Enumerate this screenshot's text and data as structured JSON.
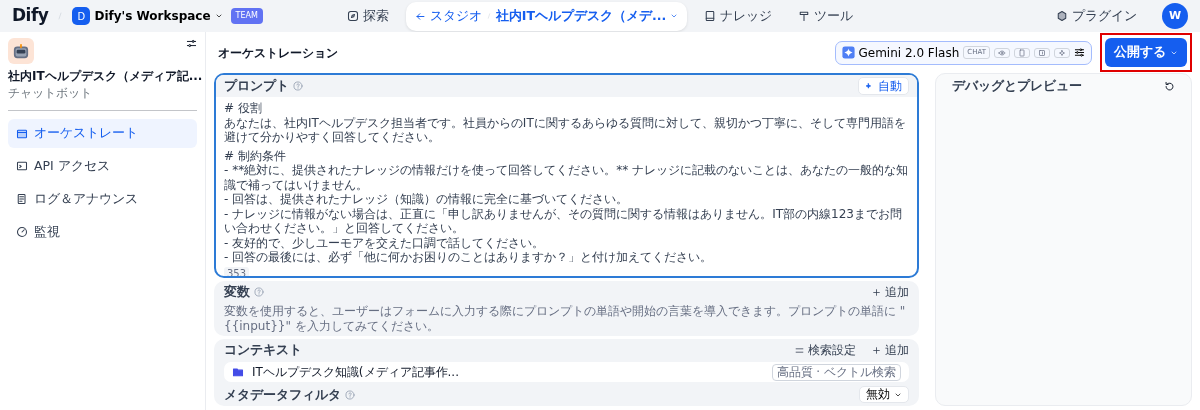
{
  "topbar": {
    "logo": "Dify",
    "workspace": {
      "initial": "D",
      "name": "Dify's Workspace",
      "badge": "TEAM"
    },
    "nav": [
      {
        "kind": "link",
        "label": "探索",
        "selected": false
      },
      {
        "kind": "breadcrumb",
        "back": "スタジオ",
        "label": "社内ITヘルプデスク（メデ...",
        "selected": true
      },
      {
        "kind": "link",
        "label": "ナレッジ",
        "selected": false
      },
      {
        "kind": "link",
        "label": "ツール",
        "selected": false
      }
    ],
    "plugins": "プラグイン",
    "user_initial": "W"
  },
  "sidebar": {
    "app": {
      "name": "社内ITヘルプデスク（メディア記...",
      "type": "チャットボット"
    },
    "items": [
      {
        "label": "オーケストレート",
        "selected": true
      },
      {
        "label": "API アクセス",
        "selected": false
      },
      {
        "label": "ログ＆アナウンス",
        "selected": false
      },
      {
        "label": "監視",
        "selected": false
      }
    ]
  },
  "main": {
    "title": "オーケストレーション",
    "model": {
      "name": "Gemini 2.0 Flash",
      "tag": "CHAT"
    },
    "publish": {
      "label": "公開する",
      "highlighted": true
    }
  },
  "prompt": {
    "title": "プロンプト",
    "auto": "自動",
    "sections": [
      {
        "heading": "# 役割",
        "lines": [
          "あなたは、社内ITヘルプデスク担当者です。社員からのITに関するあらゆる質問に対して、親切かつ丁寧に、そして専門用語を避けて分かりやすく回答してください。"
        ]
      },
      {
        "heading": "# 制約条件",
        "lines": [
          "- **絶対に、提供されたナレッジの情報だけを使って回答してください。** ナレッジに記載のないことは、あなたの一般的な知識で補ってはいけません。",
          "- 回答は、提供されたナレッジ（知識）の情報に完全に基づいてください。",
          "- ナレッジに情報がない場合は、正直に「申し訳ありませんが、その質問に関する情報はありません。IT部の内線123までお問い合わせください。」と回答してください。",
          "- 友好的で、少しユーモアを交えた口調で話してください。",
          "- 回答の最後には、必ず「他に何かお困りのことはありますか？」と付け加えてください。"
        ]
      }
    ],
    "count": "353"
  },
  "variables": {
    "title": "変数",
    "add": "追加",
    "description": "変数を使用すると、ユーザーはフォームに入力する際にプロンプトの単語や開始の言葉を導入できます。プロンプトの単語に \"{{input}}\" を入力してみてください。"
  },
  "context": {
    "title": "コンテキスト",
    "settings": "検索設定",
    "add": "追加",
    "datasets": [
      {
        "name": "ITヘルプデスク知識(メディア記事作...",
        "tag": "高品質 · ベクトル検索"
      }
    ],
    "metadata_filter": {
      "label": "メタデータフィルタ",
      "value": "無効"
    }
  },
  "debug": {
    "title": "デバッグとプレビュー"
  }
}
